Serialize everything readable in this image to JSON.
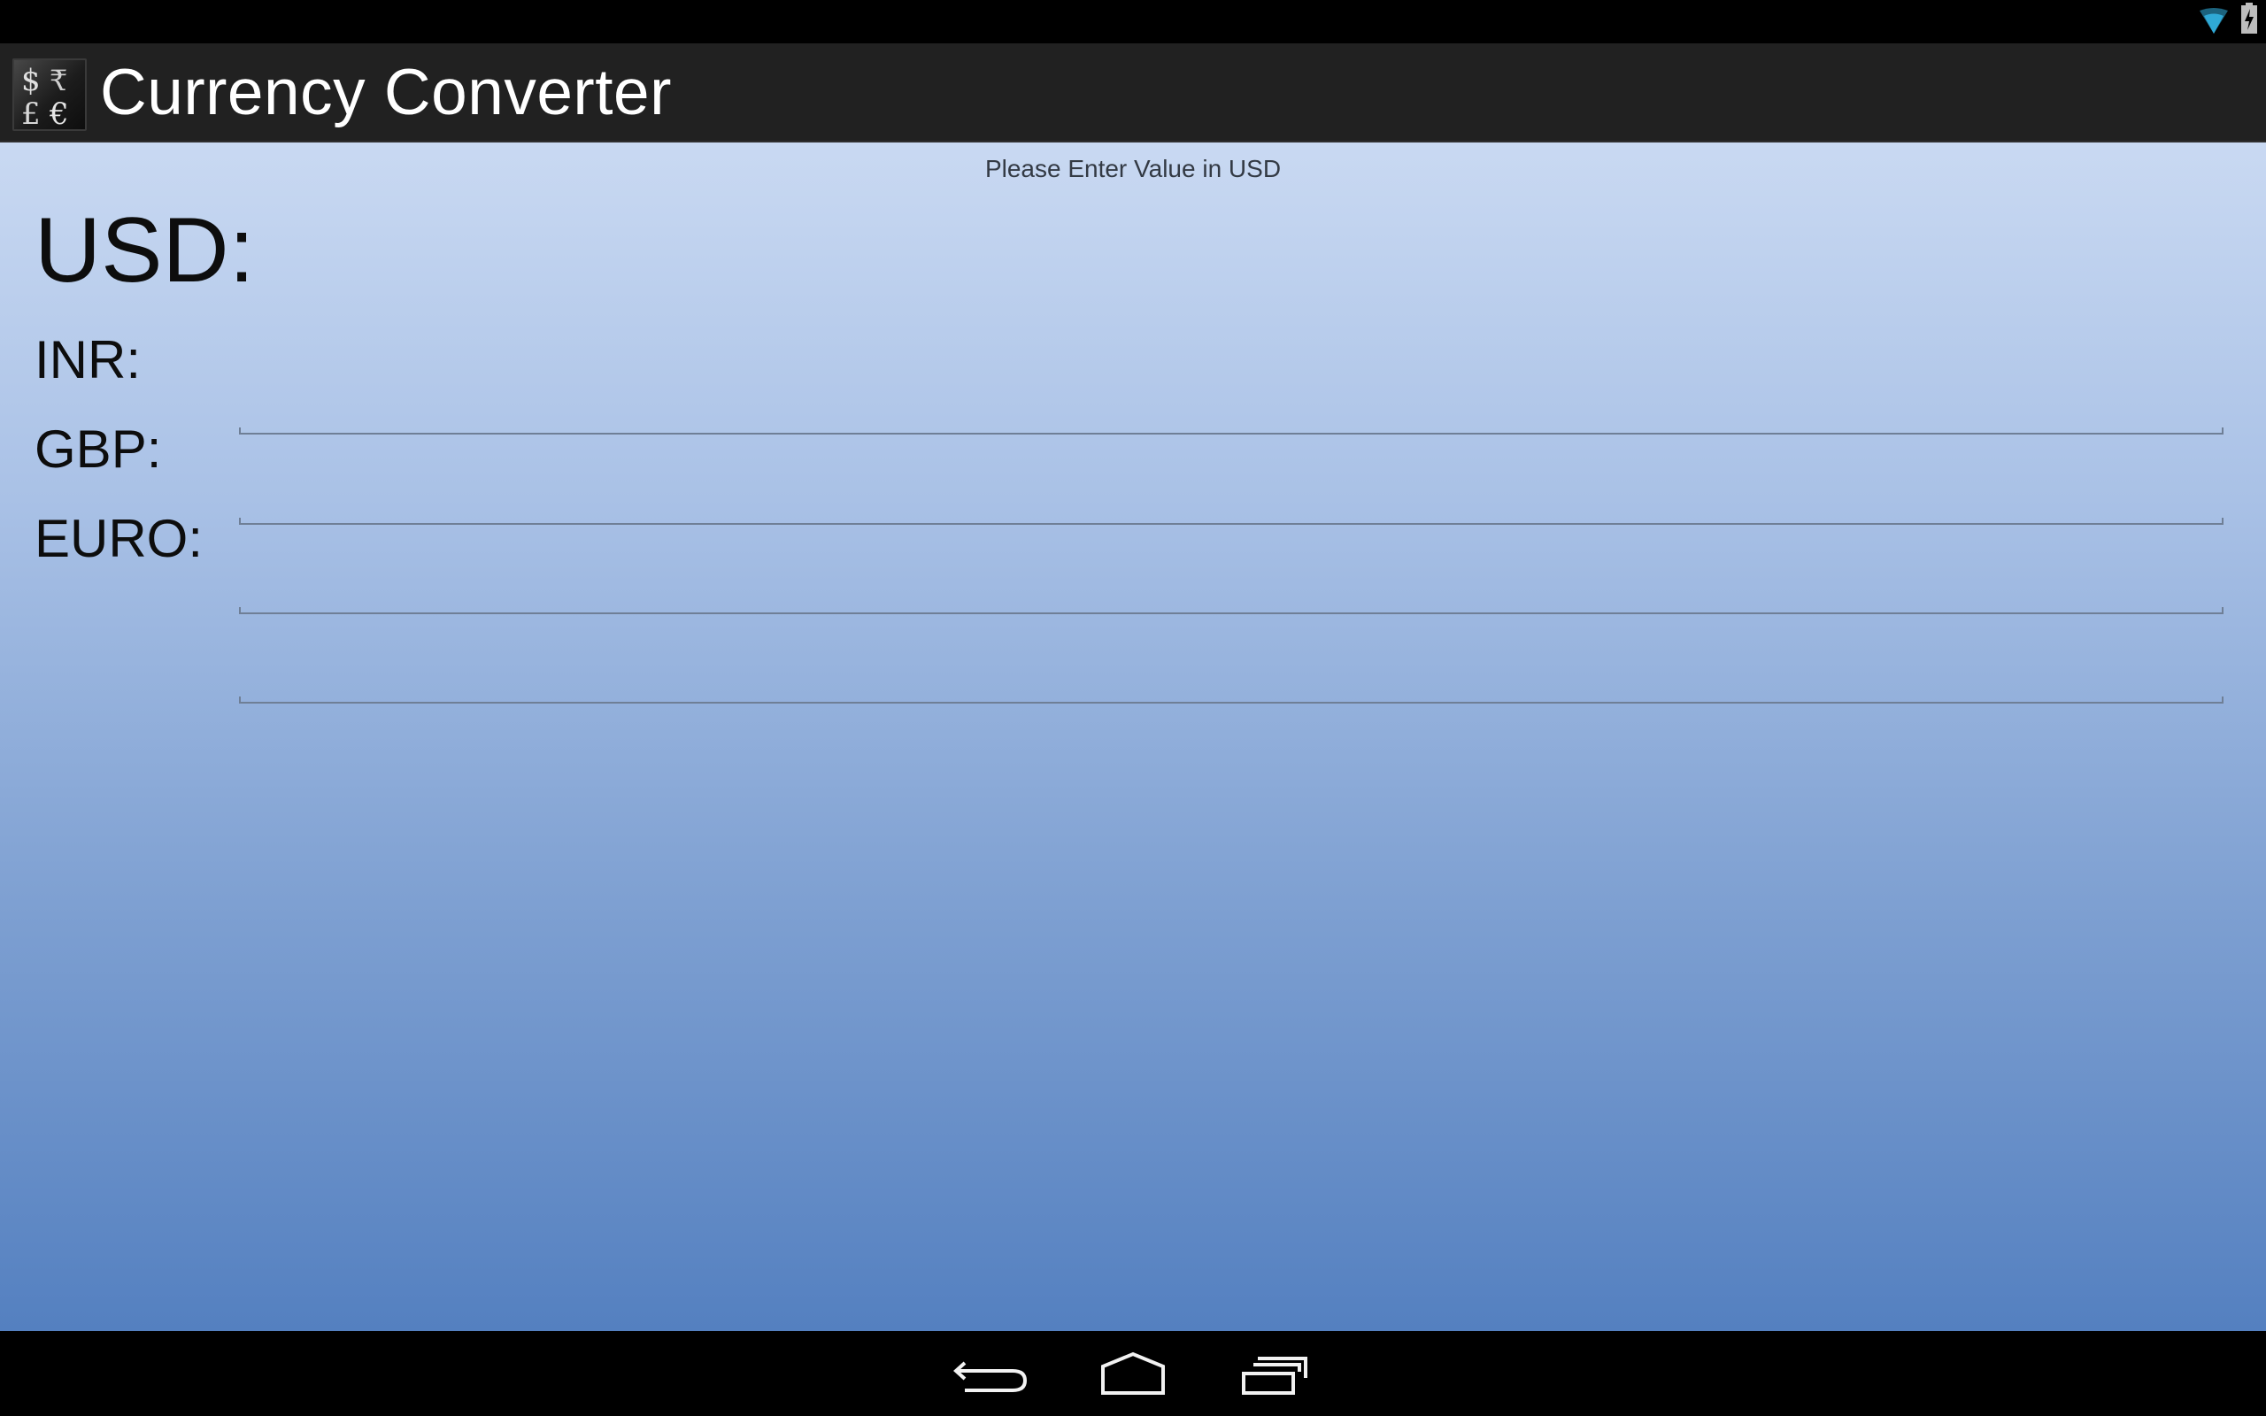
{
  "status_bar": {
    "icons": [
      "wifi-icon",
      "battery-charging-icon"
    ]
  },
  "action_bar": {
    "app_icon": "currency-symbols-icon",
    "app_icon_glyphs": [
      "$",
      "₹",
      "£",
      "€"
    ],
    "title": "Currency Converter"
  },
  "content": {
    "prompt": "Please Enter Value in USD",
    "rows": [
      {
        "label": "USD:",
        "value": "",
        "placeholder": ""
      },
      {
        "label": "INR:",
        "value": "",
        "placeholder": ""
      },
      {
        "label": "GBP:",
        "value": "",
        "placeholder": ""
      },
      {
        "label": "EURO:",
        "value": "",
        "placeholder": ""
      }
    ]
  },
  "nav_bar": {
    "buttons": [
      "back-icon",
      "home-icon",
      "recent-apps-icon"
    ]
  },
  "colors": {
    "action_bar_bg": "#212121",
    "gradient_top": "#c9d9f2",
    "gradient_bottom": "#5480c0",
    "text": "#0d0d0d",
    "underline": "#6f7f96"
  }
}
